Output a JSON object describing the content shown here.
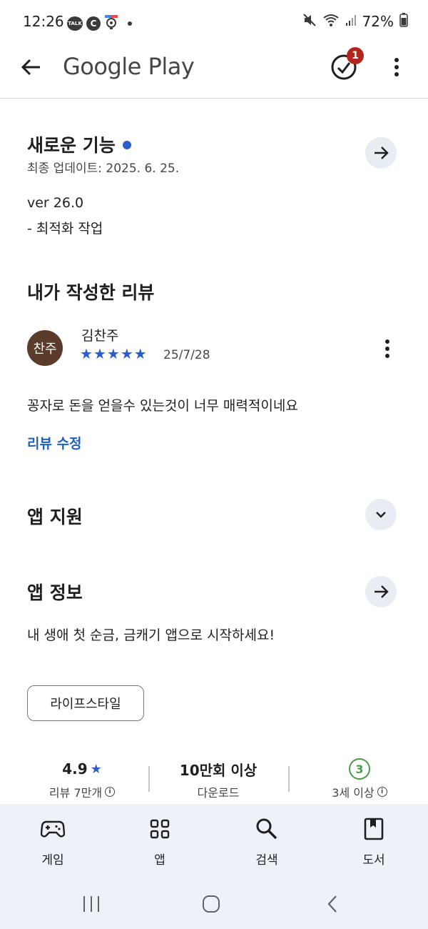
{
  "status_bar": {
    "time": "12:26",
    "talk_label": "TALK",
    "c_label": "C",
    "battery": "72%"
  },
  "app_bar": {
    "title": "Google Play",
    "notification_count": "1"
  },
  "whats_new": {
    "title": "새로운 기능",
    "last_updated": "최종 업데이트: 2025. 6. 25.",
    "version": "ver 26.0",
    "notes": "- 최적화 작업"
  },
  "my_review": {
    "title": "내가 작성한 리뷰",
    "avatar_text": "찬주",
    "reviewer": "김찬주",
    "rating": 5,
    "stars": [
      "★",
      "★",
      "★",
      "★",
      "★"
    ],
    "date": "25/7/28",
    "text": "꽁자로 돈을 얻을수 있는것이 너무 매력적이네요",
    "edit_label": "리뷰 수정"
  },
  "app_support": {
    "title": "앱 지원"
  },
  "app_info": {
    "title": "앱 정보",
    "description": "내 생애 첫 순금, 금캐기 앱으로 시작하세요!",
    "category_chip": "라이프스타일"
  },
  "stats": {
    "rating": "4.9",
    "rating_star": "★",
    "reviews_label": "리뷰 7만개",
    "downloads": "10만회 이상",
    "downloads_label": "다운로드",
    "age_value": "3",
    "age_label": "3세 이상",
    "info_glyph": "i"
  },
  "bottom_nav": {
    "items": [
      {
        "label": "게임",
        "icon": "gamepad-icon"
      },
      {
        "label": "앱",
        "icon": "apps-grid-icon"
      },
      {
        "label": "검색",
        "icon": "search-icon"
      },
      {
        "label": "도서",
        "icon": "book-icon"
      }
    ]
  },
  "colors": {
    "accent_blue": "#2b5ccc",
    "link_blue": "#1f5fbf",
    "badge_red": "#b3261e",
    "avatar_brown": "#5b3b2a",
    "age_green": "#4a9b4a",
    "nav_bg": "#eef2f8"
  }
}
